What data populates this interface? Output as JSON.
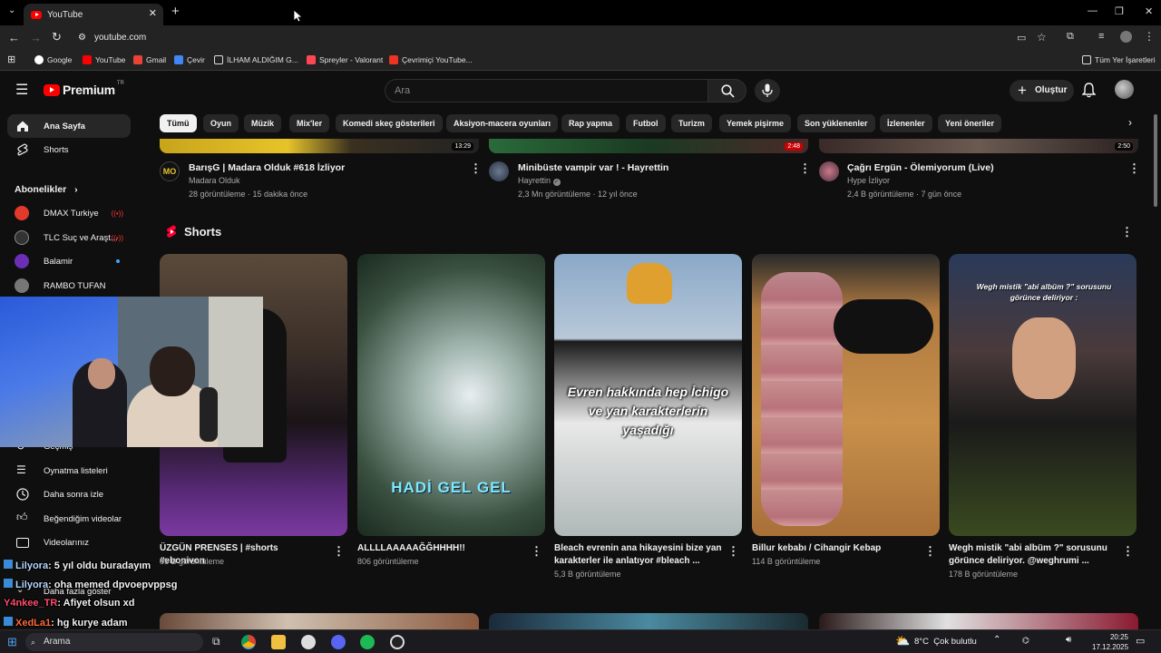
{
  "browser": {
    "tab_title": "YouTube",
    "url": "youtube.com",
    "bookmarks": [
      "Google",
      "YouTube",
      "Gmail",
      "Çevir",
      "İLHAM ALDIĞIM G...",
      "Spreyler - Valorant",
      "Çevrimiçi YouTube..."
    ],
    "all_bookmarks": "Tüm Yer İşaretleri"
  },
  "header": {
    "logo": "Premium",
    "logo_sup": "TR",
    "search_placeholder": "Ara",
    "create_label": "Oluştur"
  },
  "chips": [
    "Tümü",
    "Oyun",
    "Müzik",
    "Mix'ler",
    "Komedi skeç gösterileri",
    "Aksiyon-macera oyunları",
    "Rap yapma",
    "Futbol",
    "Turizm",
    "Yemek pişirme",
    "Son yüklenenler",
    "İzlenenler",
    "Yeni öneriler"
  ],
  "sidebar": {
    "home": "Ana Sayfa",
    "shorts": "Shorts",
    "subs_title": "Abonelikler",
    "channels": [
      "DMAX Turkiye",
      "TLC Suç ve Araşt...",
      "Balamir",
      "RAMBO TUFAN"
    ],
    "history": "Geçmiş",
    "playlists": "Oynatma listeleri",
    "watch_later": "Daha sonra izle",
    "liked": "Beğendiğim videolar",
    "your_videos": "Videolarınız",
    "show_more": "Daha fazla göster"
  },
  "videos": [
    {
      "title": "BarışG | Madara Olduk #618 İzliyor",
      "channel": "Madara Olduk",
      "meta": "28 görüntüleme · 15 dakika önce",
      "duration": "13:29",
      "avatar": "MO"
    },
    {
      "title": "Minibüste vampir var ! - Hayrettin",
      "channel": "Hayrettin",
      "meta": "2,3 Mn görüntüleme · 12 yıl önce",
      "duration": "2:48"
    },
    {
      "title": "Çağrı Ergün - Ölemiyorum (Live)",
      "channel": "Hype İzliyor",
      "meta": "2,4 B görüntüleme · 7 gün önce",
      "duration": "2:50"
    }
  ],
  "shorts": {
    "heading": "Shorts",
    "items": [
      {
        "title": "ÜZGÜN PRENSES | #shorts #ebonivon",
        "views": "65 B görüntüleme",
        "overlay": ""
      },
      {
        "title": "ALLLLAAAAAĞĞHHHH!!",
        "views": "806 görüntüleme",
        "overlay": "HADİ GEL GEL"
      },
      {
        "title": "Bleach evrenin ana hikayesini bize yan karakterler ile anlatıyor #bleach ...",
        "views": "5,3 B görüntüleme",
        "overlay": "Evren hakkında hep İchigo ve yan karakterlerin yaşadığı"
      },
      {
        "title": "Billur kebabı / Cihangir Kebap",
        "views": "114 B görüntüleme",
        "overlay": ""
      },
      {
        "title": "Wegh mistik \"abi albüm ?\" sorusunu görünce deliriyor. @weghrumi ...",
        "views": "178 B görüntüleme",
        "overlay": "Wegh mistik \"abi albüm ?\" sorusunu görünce deliriyor :"
      }
    ]
  },
  "chat": [
    {
      "user": "Lilyora",
      "msg": ": 5 yıl oldu buradayım",
      "color": "#b6d7ff"
    },
    {
      "user": "Lilyora",
      "msg": ": oha memed dpvoepvppsg",
      "color": "#b6d7ff"
    },
    {
      "user": "Y4nkee_TR",
      "msg": ": Afiyet olsun xd",
      "color": "#ff4d6d"
    },
    {
      "user": "XedLa1",
      "msg": ": hg kurye adam",
      "color": "#ff6a3d"
    }
  ],
  "taskbar": {
    "search": "Arama",
    "weather": "8°C  Çok bulutlu",
    "time": "20:25",
    "date": "17.12.2025"
  }
}
